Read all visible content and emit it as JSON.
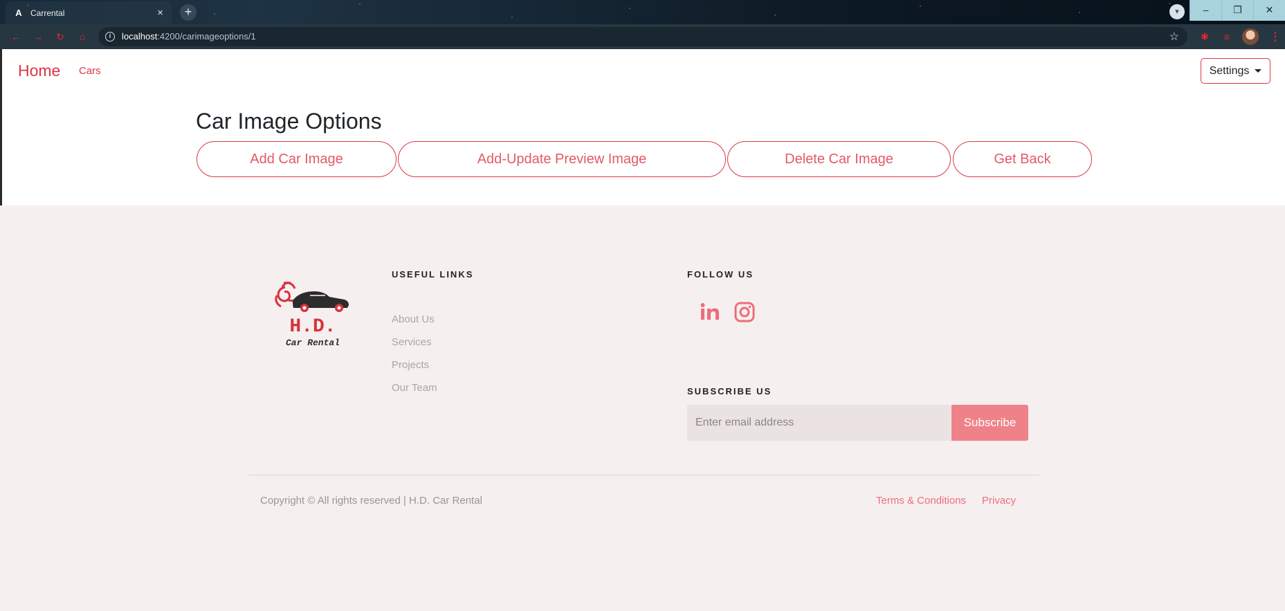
{
  "browser": {
    "tab_title": "Carrental",
    "tab_icon": "angular-icon",
    "url_host": "localhost",
    "url_path": ":4200/carimageoptions/1",
    "close_symbol": "×",
    "new_tab_symbol": "+"
  },
  "navbar": {
    "home_label": "Home",
    "cars_label": "Cars",
    "settings_label": "Settings"
  },
  "main": {
    "title": "Car Image Options",
    "buttons": [
      {
        "label": "Add Car Image"
      },
      {
        "label": "Add-Update Preview Image"
      },
      {
        "label": "Delete Car Image"
      },
      {
        "label": "Get Back"
      }
    ]
  },
  "footer": {
    "logo": {
      "name": "H.D.",
      "tagline": "Car Rental"
    },
    "useful_links_heading": "USEFUL LINKS",
    "useful_links": [
      "About Us",
      "Services",
      "Projects",
      "Our Team"
    ],
    "follow_heading": "FOLLOW US",
    "social": [
      "linkedin-icon",
      "instagram-icon"
    ],
    "subscribe_heading": "SUBSCRIBE US",
    "email_placeholder": "Enter email address",
    "subscribe_label": "Subscribe",
    "copyright": "Copyright © All rights reserved | H.D. Car Rental",
    "bottom_links": [
      "Terms & Conditions",
      "Privacy"
    ]
  },
  "colors": {
    "accent": "#dc3545",
    "button_text": "#e35a66",
    "footer_bg": "#f6eff0",
    "subscribe_bg": "#ef8288"
  }
}
